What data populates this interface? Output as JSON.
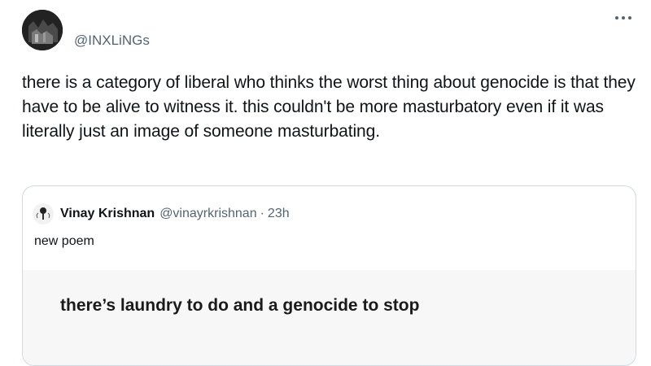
{
  "tweet": {
    "author_handle": "@INXLiNGs",
    "text": "there is a category of liberal who thinks the worst thing about genocide is that they have to be alive to witness it. this couldn't be more masturbatory even if it was literally just an image of someone masturbating.",
    "more_icon": "more-horizontal-icon"
  },
  "quote": {
    "author_name": "Vinay Krishnan",
    "author_handle": "@vinayrkrishnan",
    "separator": "·",
    "time": "23h",
    "text": "new poem",
    "media_text": "there’s laundry to do and a genocide to stop"
  }
}
